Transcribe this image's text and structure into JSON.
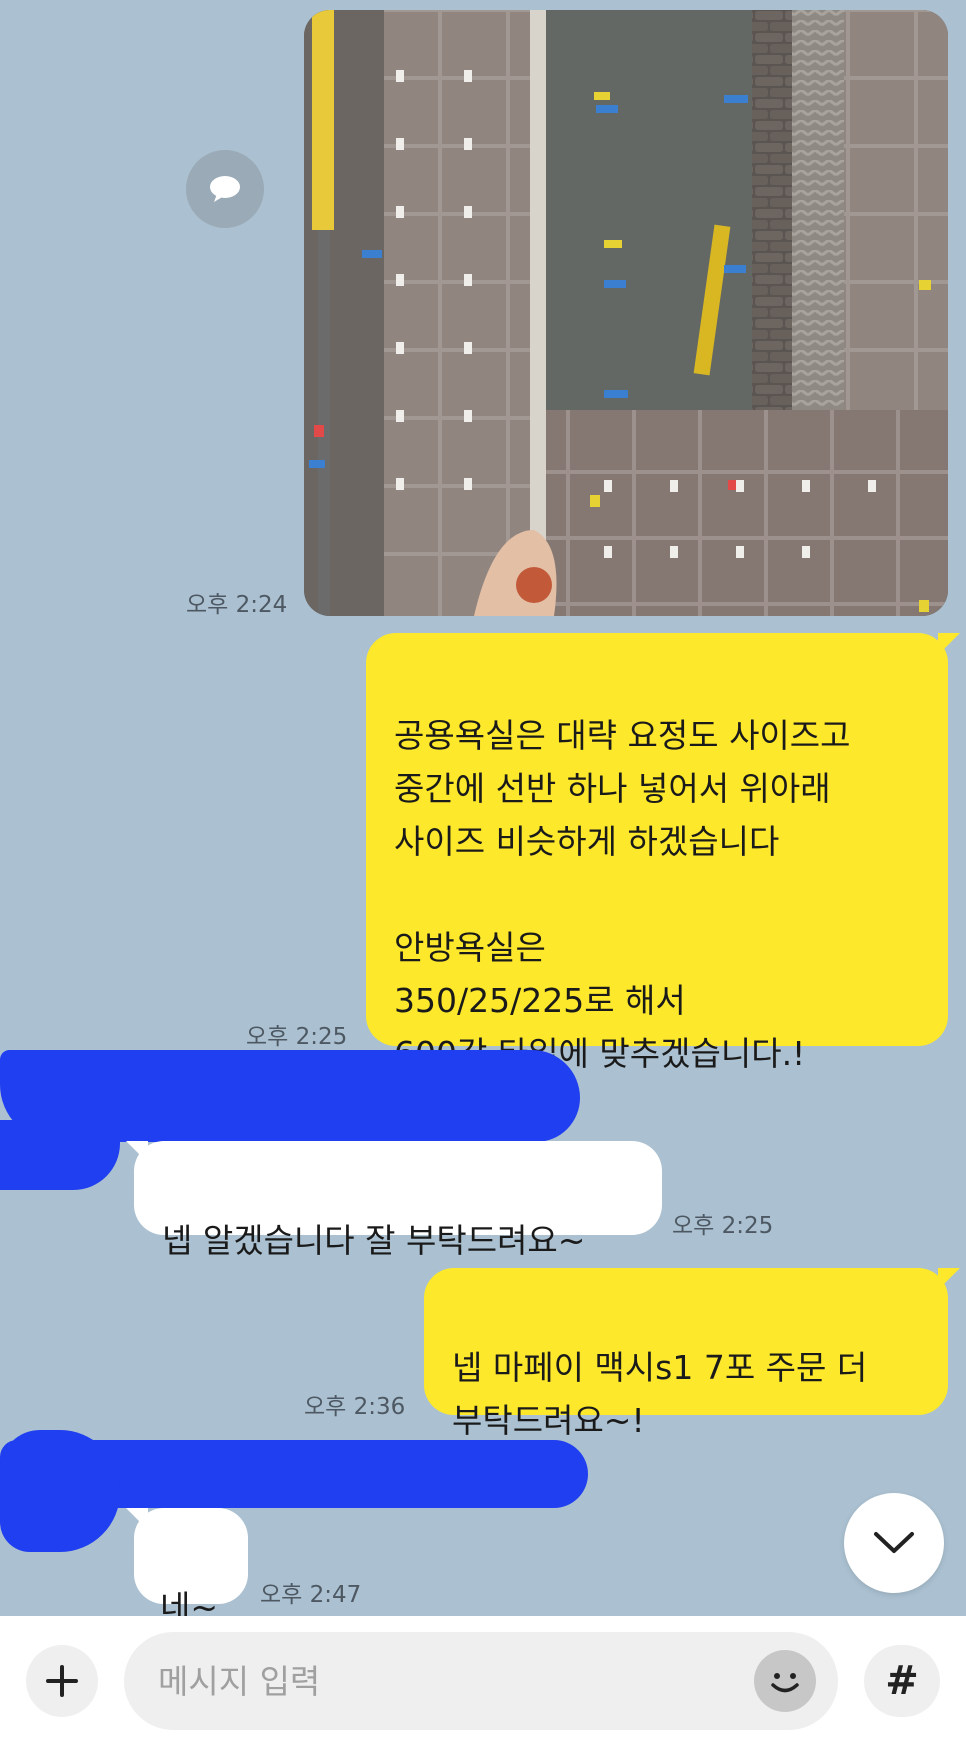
{
  "messages": [
    {
      "id": "m1",
      "side": "mine",
      "type": "photo",
      "time": "오후 2:24"
    },
    {
      "id": "m2",
      "side": "mine",
      "type": "text",
      "text": "공용욕실은 대략 요정도 사이즈고\n중간에 선반 하나 넣어서 위아래\n사이즈 비슷하게 하겠습니다\n\n안방욕실은\n350/25/225로 해서\n600각 타일에 맞추겠습니다.!",
      "time": "오후 2:25"
    },
    {
      "id": "m3",
      "side": "theirs",
      "type": "text",
      "text": "넵 알겠습니다 잘 부탁드려요~",
      "time": "오후 2:25"
    },
    {
      "id": "m4",
      "side": "mine",
      "type": "text",
      "text": "넵 마페이 맥시s1 7포 주문 더\n부탁드려요~!",
      "time": "오후 2:36"
    },
    {
      "id": "m5",
      "side": "theirs",
      "type": "text",
      "text": "네~",
      "time": "오후 2:47"
    }
  ],
  "composer": {
    "placeholder": "메시지 입력",
    "plus_icon": "plus-icon",
    "emoji_icon": "smiley-icon",
    "hash_label": "#"
  },
  "icons": {
    "share": "speech-bubble-icon",
    "scroll_down": "chevron-down-icon"
  },
  "colors": {
    "background": "#abc1d1",
    "my_bubble": "#fde82c",
    "their_bubble": "#ffffff",
    "redaction": "#1f3ff0"
  }
}
